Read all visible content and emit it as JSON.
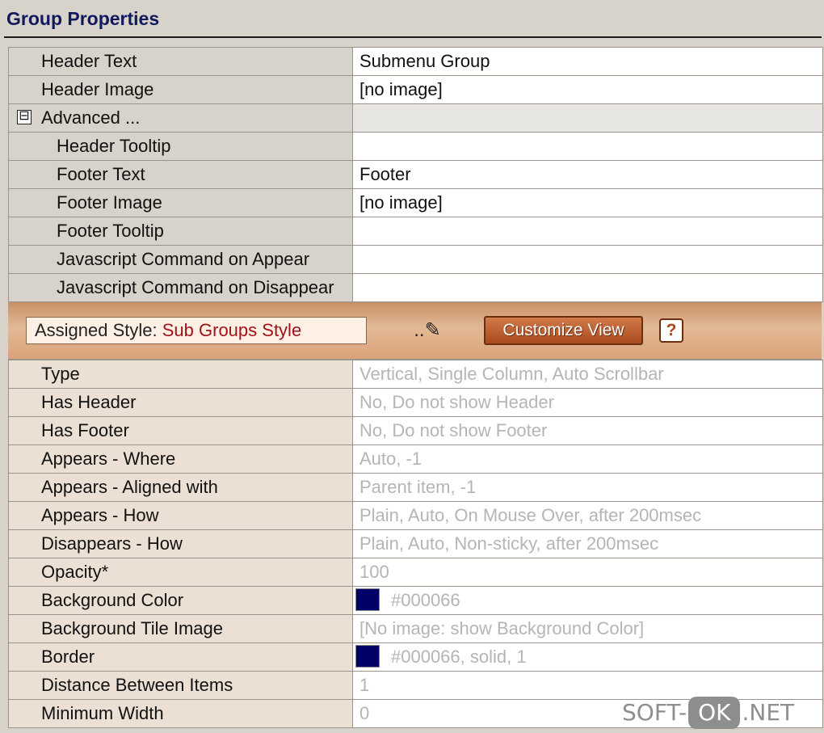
{
  "title": "Group Properties",
  "properties": [
    {
      "label": "Header Text",
      "value": "Submenu Group",
      "kind": "top"
    },
    {
      "label": "Header Image",
      "value": "[no image]",
      "kind": "top"
    },
    {
      "label": "Advanced ...",
      "value": "",
      "kind": "section",
      "expander_glyph": "⊟"
    },
    {
      "label": "Header Tooltip",
      "value": "",
      "kind": "indent"
    },
    {
      "label": "Footer Text",
      "value": "Footer",
      "kind": "indent"
    },
    {
      "label": "Footer Image",
      "value": "[no image]",
      "kind": "indent"
    },
    {
      "label": "Footer Tooltip",
      "value": "",
      "kind": "indent"
    },
    {
      "label": "Javascript Command on Appear",
      "value": "",
      "kind": "indent"
    },
    {
      "label": "Javascript Command on Disappear",
      "value": "",
      "kind": "indent"
    }
  ],
  "style_bar": {
    "assigned_label": "Assigned Style: ",
    "assigned_value": "Sub Groups Style",
    "edit_label": "..✎",
    "customize_label": "Customize View",
    "help_label": "?"
  },
  "style_properties": [
    {
      "label": "Type",
      "value": "Vertical, Single Column, Auto Scrollbar"
    },
    {
      "label": "Has Header",
      "value": "No, Do not show Header"
    },
    {
      "label": "Has Footer",
      "value": "No, Do not show Footer"
    },
    {
      "label": "Appears - Where",
      "value": "Auto, -1"
    },
    {
      "label": "Appears - Aligned with",
      "value": "Parent item, -1"
    },
    {
      "label": "Appears - How",
      "value": "Plain, Auto, On Mouse Over, after 200msec"
    },
    {
      "label": "Disappears - How",
      "value": "Plain, Auto, Non-sticky, after 200msec"
    },
    {
      "label": "Opacity*",
      "value": "100"
    },
    {
      "label": "Background Color",
      "value": "#000066",
      "swatch": "#000066"
    },
    {
      "label": "Background Tile Image",
      "value": "[No image: show Background Color]"
    },
    {
      "label": "Border",
      "value": "#000066, solid, 1",
      "swatch": "#000066"
    },
    {
      "label": "Distance Between Items",
      "value": "1"
    },
    {
      "label": "Minimum Width",
      "value": "0"
    }
  ],
  "watermark": {
    "left": "SOFT-",
    "middle": "OK",
    "right": ".NET"
  }
}
